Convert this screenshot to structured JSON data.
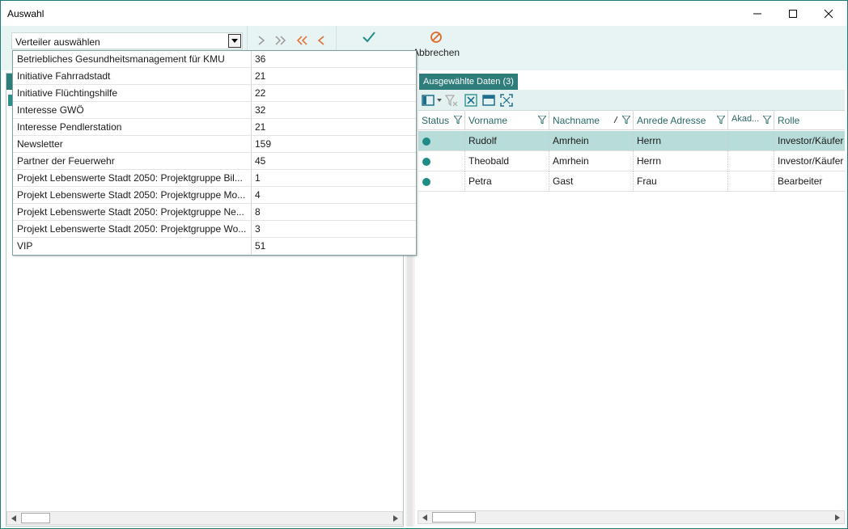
{
  "window": {
    "title": "Auswahl"
  },
  "toolbar": {
    "combo_value": "Verteiler auswählen",
    "confirm_label": "",
    "cancel_label": "Abbrechen",
    "accent_color": "#1f8d86",
    "arrow_grey": "#9a9a9a",
    "arrow_orange": "#e06a2a"
  },
  "dropdown": {
    "items": [
      {
        "name": "Betriebliches Gesundheitsmanagement für KMU",
        "count": "36"
      },
      {
        "name": "Initiative Fahrradstadt",
        "count": "21"
      },
      {
        "name": "Initiative Flüchtingshilfe",
        "count": "22"
      },
      {
        "name": "Interesse GWÖ",
        "count": "32"
      },
      {
        "name": "Interesse Pendlerstation",
        "count": "21"
      },
      {
        "name": "Newsletter",
        "count": "159"
      },
      {
        "name": "Partner der Feuerwehr",
        "count": "45"
      },
      {
        "name": "Projekt Lebenswerte Stadt 2050: Projektgruppe Bil...",
        "count": "1"
      },
      {
        "name": "Projekt Lebenswerte Stadt 2050: Projektgruppe Mo...",
        "count": "4"
      },
      {
        "name": "Projekt Lebenswerte Stadt 2050: Projektgruppe Ne...",
        "count": "8"
      },
      {
        "name": "Projekt Lebenswerte Stadt 2050: Projektgruppe Wo...",
        "count": "3"
      },
      {
        "name": "VIP",
        "count": "51"
      }
    ]
  },
  "right": {
    "tab_label": "Ausgewählte Daten (3)",
    "columns": [
      "Status",
      "Vorname",
      "Nachname",
      "Anrede Adresse",
      "Akad...",
      "Rolle"
    ],
    "rows": [
      {
        "vorname": "Rudolf",
        "nachname": "Amrhein",
        "anrede": "Herrn",
        "akad": "",
        "rolle": "Investor/Käufer",
        "selected": true
      },
      {
        "vorname": "Theobald",
        "nachname": "Amrhein",
        "anrede": "Herrn",
        "akad": "",
        "rolle": "Investor/Käufer",
        "selected": false
      },
      {
        "vorname": "Petra",
        "nachname": "Gast",
        "anrede": "Frau",
        "akad": "",
        "rolle": "Bearbeiter",
        "selected": false
      }
    ]
  }
}
